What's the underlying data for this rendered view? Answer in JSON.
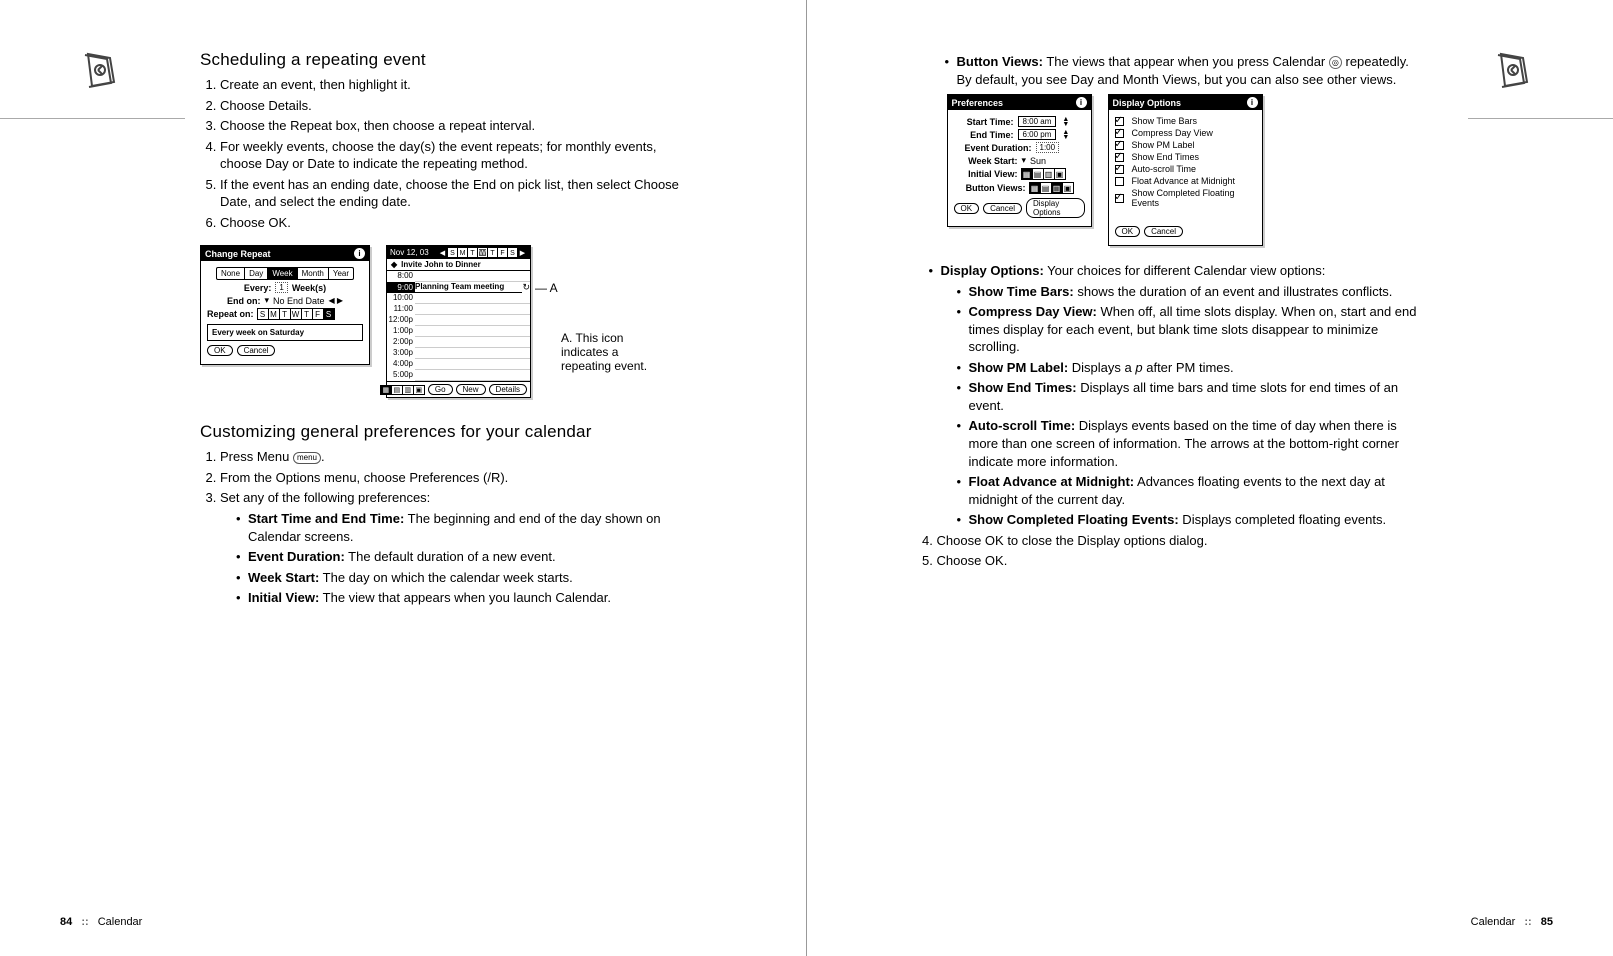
{
  "pages": {
    "left": {
      "number": "84",
      "section": "Calendar"
    },
    "right": {
      "number": "85",
      "section": "Calendar"
    }
  },
  "section1": {
    "heading": "Scheduling a repeating event",
    "steps": [
      "Create an event, then highlight it.",
      "Choose Details.",
      "Choose the Repeat box, then choose a repeat interval.",
      "For weekly events, choose the day(s) the event repeats; for monthly events, choose Day or Date to indicate the repeating method.",
      "If the event has an ending date, choose the End on pick list, then select Choose Date, and select the ending date.",
      "Choose OK."
    ]
  },
  "change_repeat": {
    "title": "Change Repeat",
    "tabs": [
      "None",
      "Day",
      "Week",
      "Month",
      "Year"
    ],
    "selected_tab": "Week",
    "every_label": "Every:",
    "every_value": "1",
    "every_unit": "Week(s)",
    "end_label": "End on:",
    "end_value": "No End Date",
    "repeat_label": "Repeat on:",
    "days": [
      "S",
      "M",
      "T",
      "W",
      "T",
      "F",
      "S"
    ],
    "day_selected": "S",
    "summary": "Every week on Saturday",
    "ok": "OK",
    "cancel": "Cancel"
  },
  "dayview": {
    "date": "Nov 12, 03",
    "weekdays": [
      "S",
      "M",
      "T",
      "W",
      "T",
      "F",
      "S"
    ],
    "weekday_selected": "W",
    "allday": "Invite John to Dinner",
    "slots": [
      "8:00",
      "9:00",
      "10:00",
      "11:00",
      "12:00p",
      "1:00p",
      "2:00p",
      "3:00p",
      "4:00p",
      "5:00p"
    ],
    "event_time": "9:00",
    "event_title": "Planning Team meeting",
    "go": "Go",
    "new": "New",
    "details": "Details"
  },
  "callouts": {
    "a_marker": "A",
    "a_text": "A. This icon indicates a repeating event."
  },
  "section2": {
    "heading": "Customizing general preferences for your calendar",
    "step1_a": "Press Menu ",
    "step1_b": ".",
    "menu_label": "menu",
    "step2": "From the Options menu, choose Preferences (/R).",
    "step3": "Set any of the following preferences:",
    "bullets": [
      {
        "term": "Start Time and End Time:",
        "desc": " The beginning and end of the day shown on Calendar screens."
      },
      {
        "term": "Event Duration:",
        "desc": " The default duration of a new event."
      },
      {
        "term": "Week Start:",
        "desc": " The day on which the calendar week starts."
      },
      {
        "term": "Initial View:",
        "desc": " The view that appears when you launch Calendar."
      }
    ]
  },
  "right_intro": {
    "term": "Button Views:",
    "desc_a": " The views that appear when you press Calendar ",
    "desc_b": " repeatedly. By default, you see Day and Month Views, but you can also see other views."
  },
  "prefs_dialog": {
    "title": "Preferences",
    "start_label": "Start Time:",
    "start_value": "8:00 am",
    "end_label": "End Time:",
    "end_value": "6:00 pm",
    "duration_label": "Event Duration:",
    "duration_value": "1:00",
    "week_label": "Week Start:",
    "week_value": "Sun",
    "initial_label": "Initial View:",
    "button_label": "Button Views:",
    "ok": "OK",
    "cancel": "Cancel",
    "dispopt": "Display Options"
  },
  "disp_dialog": {
    "title": "Display Options",
    "opts": [
      {
        "c": true,
        "t": "Show Time Bars"
      },
      {
        "c": true,
        "t": "Compress Day View"
      },
      {
        "c": true,
        "t": "Show PM Label"
      },
      {
        "c": true,
        "t": "Show End Times"
      },
      {
        "c": true,
        "t": "Auto-scroll Time"
      },
      {
        "c": false,
        "t": "Float Advance at Midnight"
      },
      {
        "c": true,
        "t": "Show Completed Floating Events"
      }
    ],
    "ok": "OK",
    "cancel": "Cancel"
  },
  "right_section": {
    "intro_term": "Display Options:",
    "intro_desc": " Your choices for different Calendar view options:",
    "bullets": [
      {
        "term": "Show Time Bars:",
        "desc": " shows the duration of an event and illustrates conflicts."
      },
      {
        "term": "Compress Day View:",
        "desc": " When off, all time slots display. When on, start and end times display for each event, but blank time slots disappear to minimize scrolling."
      },
      {
        "term": "Show PM Label:",
        "desc_a": " Displays a ",
        "p": "p",
        "desc_b": " after PM times."
      },
      {
        "term": "Show End Times:",
        "desc": " Displays all time bars and time slots for end times of an event."
      },
      {
        "term": "Auto-scroll Time:",
        "desc": " Displays events based on the time of day when there is more than one screen of information. The arrows at the bottom-right corner indicate more information."
      },
      {
        "term": "Float Advance at Midnight:",
        "desc": " Advances floating events to the next day at midnight of the current day."
      },
      {
        "term": "Show Completed Floating Events:",
        "desc": " Displays completed floating events."
      }
    ],
    "step4": "Choose OK to close the Display options dialog.",
    "step5": "Choose OK."
  }
}
